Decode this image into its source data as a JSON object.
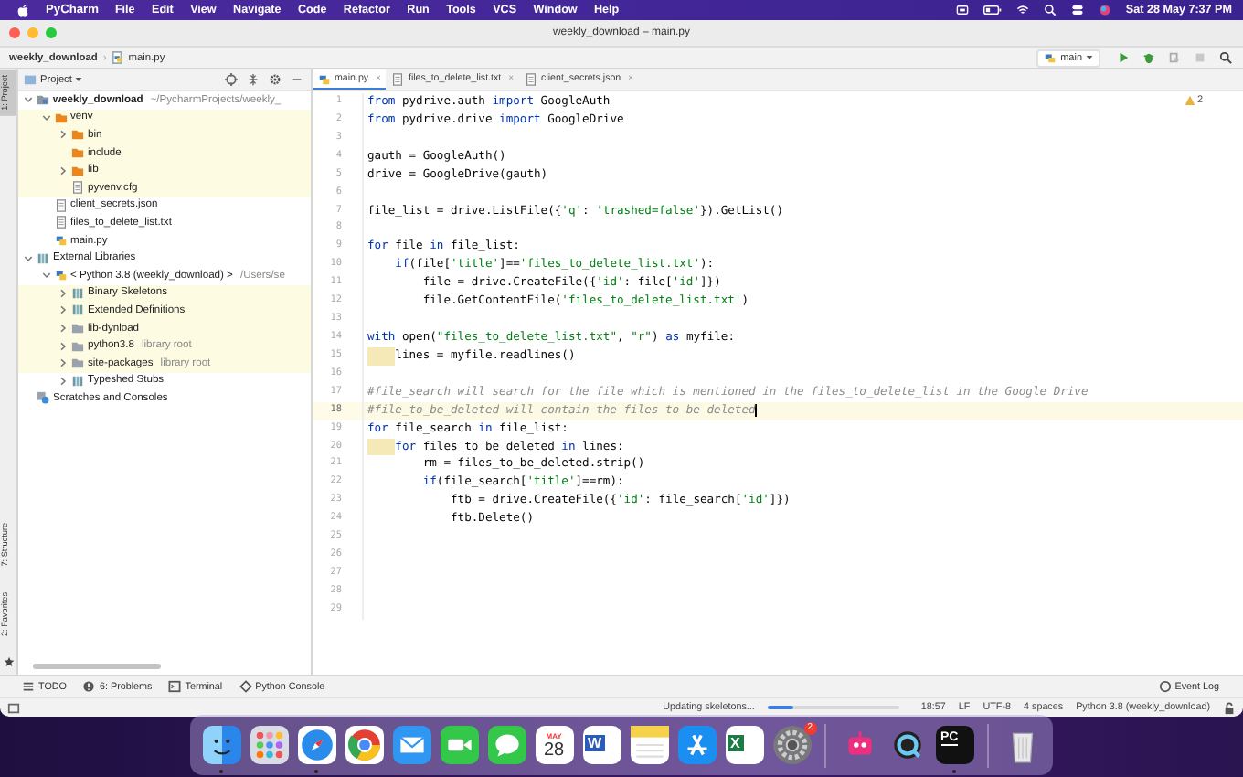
{
  "menubar": {
    "app": "PyCharm",
    "menus": [
      "File",
      "Edit",
      "View",
      "Navigate",
      "Code",
      "Refactor",
      "Run",
      "Tools",
      "VCS",
      "Window",
      "Help"
    ],
    "clock": "Sat 28 May  7:37 PM"
  },
  "window": {
    "title": "weekly_download – main.py"
  },
  "breadcrumb": {
    "project": "weekly_download",
    "separator": "›",
    "file": "main.py",
    "run_config": "main"
  },
  "stripe": {
    "top": [
      {
        "label": "1: Project",
        "selected": true
      }
    ],
    "bottom": [
      {
        "label": "7: Structure",
        "selected": false
      },
      {
        "label": "2: Favorites",
        "selected": false
      }
    ]
  },
  "project": {
    "header": "Project",
    "tree": [
      {
        "label": "weekly_download",
        "hint": "~/PycharmProjects/weekly_",
        "kind": "module",
        "expanded": true,
        "excluded": false,
        "children": [
          {
            "label": "venv",
            "kind": "venv",
            "expanded": true,
            "excluded": true,
            "children": [
              {
                "label": "bin",
                "kind": "venv",
                "expanded": false,
                "excluded": true
              },
              {
                "label": "include",
                "kind": "venv",
                "excluded": true
              },
              {
                "label": "lib",
                "kind": "venv",
                "expanded": false,
                "excluded": true
              },
              {
                "label": "pyvenv.cfg",
                "kind": "file",
                "excluded": true
              }
            ]
          },
          {
            "label": "client_secrets.json",
            "kind": "json",
            "excluded": false
          },
          {
            "label": "files_to_delete_list.txt",
            "kind": "file",
            "excluded": false
          },
          {
            "label": "main.py",
            "kind": "py",
            "excluded": false
          }
        ]
      },
      {
        "label": "External Libraries",
        "kind": "libraries",
        "expanded": true,
        "excluded": false,
        "children": [
          {
            "label": "< Python 3.8 (weekly_download) >",
            "hint": "/Users/se",
            "kind": "python",
            "expanded": true,
            "excluded": false,
            "children": [
              {
                "label": "Binary Skeletons",
                "kind": "library",
                "expanded": false,
                "excluded": true
              },
              {
                "label": "Extended Definitions",
                "kind": "library",
                "expanded": false,
                "excluded": true
              },
              {
                "label": "lib-dynload",
                "kind": "folder",
                "expanded": false,
                "excluded": true
              },
              {
                "label": "python3.8",
                "hint": "library root",
                "kind": "folder",
                "expanded": false,
                "excluded": true
              },
              {
                "label": "site-packages",
                "hint": "library root",
                "kind": "folder",
                "expanded": false,
                "excluded": true
              },
              {
                "label": "Typeshed Stubs",
                "kind": "library",
                "expanded": false,
                "excluded": false
              }
            ]
          }
        ]
      },
      {
        "label": "Scratches and Consoles",
        "kind": "scratches",
        "excluded": false
      }
    ]
  },
  "editor": {
    "tabs": [
      {
        "label": "main.py",
        "kind": "py",
        "selected": true,
        "close": "×"
      },
      {
        "label": "files_to_delete_list.txt",
        "kind": "file",
        "selected": false,
        "close": "×"
      },
      {
        "label": "client_secrets.json",
        "kind": "json",
        "selected": false,
        "close": "×"
      }
    ],
    "inspections": "2",
    "lines": [
      {
        "no": "1",
        "current": false,
        "indent_warning": false,
        "tokens": [
          {
            "kind": "keyword",
            "text": "from"
          },
          {
            "kind": "plain",
            "text": " pydrive.auth "
          },
          {
            "kind": "keyword",
            "text": "import"
          },
          {
            "kind": "plain",
            "text": " GoogleAuth"
          }
        ]
      },
      {
        "no": "2",
        "current": false,
        "indent_warning": false,
        "tokens": [
          {
            "kind": "keyword",
            "text": "from"
          },
          {
            "kind": "plain",
            "text": " pydrive.drive "
          },
          {
            "kind": "keyword",
            "text": "import"
          },
          {
            "kind": "plain",
            "text": " GoogleDrive"
          }
        ]
      },
      {
        "no": "3",
        "current": false,
        "indent_warning": false
      },
      {
        "no": "4",
        "current": false,
        "indent_warning": false,
        "tokens": [
          {
            "kind": "plain",
            "text": "gauth = GoogleAuth()"
          }
        ]
      },
      {
        "no": "5",
        "current": false,
        "indent_warning": false,
        "tokens": [
          {
            "kind": "plain",
            "text": "drive = GoogleDrive(gauth)"
          }
        ]
      },
      {
        "no": "6",
        "current": false,
        "indent_warning": false
      },
      {
        "no": "7",
        "current": false,
        "indent_warning": false,
        "tokens": [
          {
            "kind": "plain",
            "text": "file_list = drive.ListFile({"
          },
          {
            "kind": "string",
            "text": "'q'"
          },
          {
            "kind": "plain",
            "text": ": "
          },
          {
            "kind": "string",
            "text": "'trashed=false'"
          },
          {
            "kind": "plain",
            "text": "}).GetList()"
          }
        ]
      },
      {
        "no": "8",
        "current": false,
        "indent_warning": false
      },
      {
        "no": "9",
        "current": false,
        "indent_warning": false,
        "tokens": [
          {
            "kind": "keyword",
            "text": "for"
          },
          {
            "kind": "plain",
            "text": " file "
          },
          {
            "kind": "keyword",
            "text": "in"
          },
          {
            "kind": "plain",
            "text": " file_list:"
          }
        ]
      },
      {
        "no": "10",
        "current": false,
        "indent_warning": false,
        "tokens": [
          {
            "kind": "keyword",
            "text": "    if"
          },
          {
            "kind": "plain",
            "text": "(file["
          },
          {
            "kind": "string",
            "text": "'title'"
          },
          {
            "kind": "plain",
            "text": "]=="
          },
          {
            "kind": "string",
            "text": "'files_to_delete_list.txt'"
          },
          {
            "kind": "plain",
            "text": "):"
          }
        ]
      },
      {
        "no": "11",
        "current": false,
        "indent_warning": false,
        "tokens": [
          {
            "kind": "plain",
            "text": "        file = drive.CreateFile({"
          },
          {
            "kind": "string",
            "text": "'id'"
          },
          {
            "kind": "plain",
            "text": ": file["
          },
          {
            "kind": "string",
            "text": "'id'"
          },
          {
            "kind": "plain",
            "text": "]})"
          }
        ]
      },
      {
        "no": "12",
        "current": false,
        "indent_warning": false,
        "tokens": [
          {
            "kind": "plain",
            "text": "        file.GetContentFile("
          },
          {
            "kind": "string",
            "text": "'files_to_delete_list.txt'"
          },
          {
            "kind": "plain",
            "text": ")"
          }
        ]
      },
      {
        "no": "13",
        "current": false,
        "indent_warning": false
      },
      {
        "no": "14",
        "current": false,
        "indent_warning": false,
        "tokens": [
          {
            "kind": "keyword",
            "text": "with"
          },
          {
            "kind": "plain",
            "text": " open("
          },
          {
            "kind": "string",
            "text": "\"files_to_delete_list.txt\""
          },
          {
            "kind": "plain",
            "text": ", "
          },
          {
            "kind": "string",
            "text": "\"r\""
          },
          {
            "kind": "plain",
            "text": ") "
          },
          {
            "kind": "keyword",
            "text": "as"
          },
          {
            "kind": "plain",
            "text": " myfile:"
          }
        ]
      },
      {
        "no": "15",
        "current": false,
        "indent_warning": true,
        "tokens": [
          {
            "kind": "plain",
            "text": "    lines = myfile.readlines()"
          }
        ]
      },
      {
        "no": "16",
        "current": false,
        "indent_warning": false
      },
      {
        "no": "17",
        "current": false,
        "indent_warning": false,
        "tokens": [
          {
            "kind": "comment",
            "text": "#file_search will search for the file which is mentioned in the files_to_delete_list in the Google Drive"
          }
        ]
      },
      {
        "no": "18",
        "current": true,
        "indent_warning": false,
        "tokens": [
          {
            "kind": "comment",
            "text": "#file_to_be_deleted will contain the files to be deleted"
          }
        ]
      },
      {
        "no": "19",
        "current": false,
        "indent_warning": false,
        "tokens": [
          {
            "kind": "keyword",
            "text": "for"
          },
          {
            "kind": "plain",
            "text": " file_search "
          },
          {
            "kind": "keyword",
            "text": "in"
          },
          {
            "kind": "plain",
            "text": " file_list:"
          }
        ]
      },
      {
        "no": "20",
        "current": false,
        "indent_warning": true,
        "tokens": [
          {
            "kind": "keyword",
            "text": "    for"
          },
          {
            "kind": "plain",
            "text": " files_to_be_deleted "
          },
          {
            "kind": "keyword",
            "text": "in"
          },
          {
            "kind": "plain",
            "text": " lines:"
          }
        ]
      },
      {
        "no": "21",
        "current": false,
        "indent_warning": false,
        "tokens": [
          {
            "kind": "plain",
            "text": "        rm = files_to_be_deleted.strip()"
          }
        ]
      },
      {
        "no": "22",
        "current": false,
        "indent_warning": false,
        "tokens": [
          {
            "kind": "keyword",
            "text": "        if"
          },
          {
            "kind": "plain",
            "text": "(file_search["
          },
          {
            "kind": "string",
            "text": "'title'"
          },
          {
            "kind": "plain",
            "text": "]==rm):"
          }
        ]
      },
      {
        "no": "23",
        "current": false,
        "indent_warning": false,
        "tokens": [
          {
            "kind": "plain",
            "text": "            ftb = drive.CreateFile({"
          },
          {
            "kind": "string",
            "text": "'id'"
          },
          {
            "kind": "plain",
            "text": ": file_search["
          },
          {
            "kind": "string",
            "text": "'id'"
          },
          {
            "kind": "plain",
            "text": "]})"
          }
        ]
      },
      {
        "no": "24",
        "current": false,
        "indent_warning": false,
        "tokens": [
          {
            "kind": "plain",
            "text": "            ftb.Delete()"
          }
        ]
      },
      {
        "no": "25",
        "current": false,
        "indent_warning": false
      },
      {
        "no": "26",
        "current": false,
        "indent_warning": false
      },
      {
        "no": "27",
        "current": false,
        "indent_warning": false
      },
      {
        "no": "28",
        "current": false,
        "indent_warning": false
      },
      {
        "no": "29",
        "current": false,
        "indent_warning": false
      }
    ]
  },
  "tool_tabs": [
    {
      "label": "TODO",
      "kind": "todo"
    },
    {
      "label": "6: Problems",
      "kind": "problems"
    },
    {
      "label": "Terminal",
      "kind": "terminal"
    },
    {
      "label": "Python Console",
      "kind": "console"
    }
  ],
  "event_log": "Event Log",
  "status": {
    "task": "Updating skeletons...",
    "progress": {
      "level": 0.2
    },
    "items": [
      "18:57",
      "LF",
      "UTF-8",
      "4 spaces",
      "Python 3.8 (weekly_download)"
    ]
  },
  "dock": [
    {
      "kind": "face",
      "running": true
    },
    {
      "kind": "grid",
      "running": false
    },
    {
      "kind": "compass",
      "running": true
    },
    {
      "kind": "ring",
      "running": false
    },
    {
      "kind": "envelope",
      "running": false
    },
    {
      "kind": "camera",
      "running": false
    },
    {
      "kind": "bubble",
      "running": false
    },
    {
      "kind": "calendar",
      "month": "MAY",
      "day": "28",
      "running": false
    },
    {
      "kind": "document",
      "glyph": "W",
      "running": false
    },
    {
      "kind": "notes",
      "running": false
    },
    {
      "kind": "store",
      "running": false
    },
    {
      "kind": "sheet",
      "glyph": "X",
      "running": false
    },
    {
      "kind": "gear",
      "badge": "2",
      "running": false
    },
    {
      "kind": "divider"
    },
    {
      "kind": "robot",
      "running": false
    },
    {
      "kind": "magnifier",
      "running": false
    },
    {
      "kind": "code",
      "glyph": "PC",
      "running": true
    },
    {
      "kind": "divider"
    },
    {
      "kind": "trash",
      "running": false
    }
  ]
}
